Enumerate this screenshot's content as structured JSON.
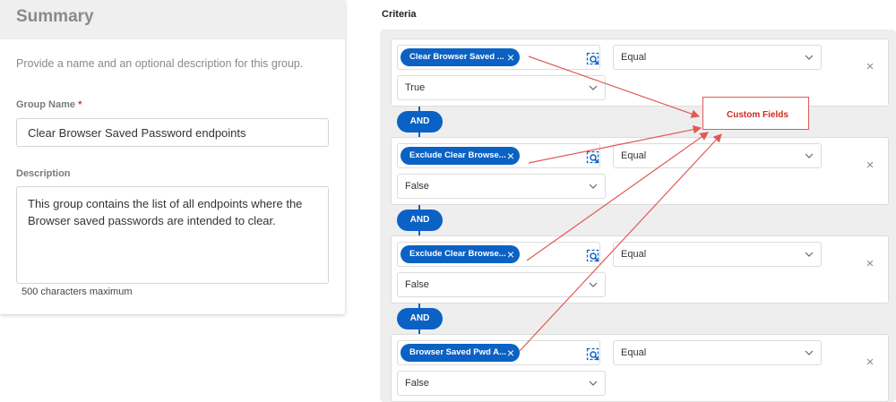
{
  "summary": {
    "title": "Summary",
    "description": "Provide a name and an optional description for this group.",
    "group_name_label": "Group Name",
    "required_mark": "*",
    "group_name_value": "Clear Browser Saved Password endpoints",
    "description_label": "Description",
    "description_value": "This group contains the list of all endpoints where the Browser saved passwords are intended to clear.",
    "char_limit": "500 characters maximum"
  },
  "criteria": {
    "title": "Criteria",
    "connector_label": "AND",
    "rows": [
      {
        "field": "Clear Browser Saved ...",
        "operator": "Equal",
        "value": "True"
      },
      {
        "field": "Exclude Clear Browse...",
        "operator": "Equal",
        "value": "False"
      },
      {
        "field": "Exclude Clear Browse...",
        "operator": "Equal",
        "value": "False"
      },
      {
        "field": "Browser Saved Pwd A...",
        "operator": "Equal",
        "value": "False"
      }
    ]
  },
  "annotation": {
    "label": "Custom Fields",
    "color": "#d12a20"
  },
  "colors": {
    "accent": "#0b62c4",
    "annotation": "#e05a55"
  },
  "icons": {
    "chip_close": "close-icon",
    "field_picker": "search-field-icon",
    "dropdown": "chevron-down-icon",
    "remove": "remove-icon"
  }
}
